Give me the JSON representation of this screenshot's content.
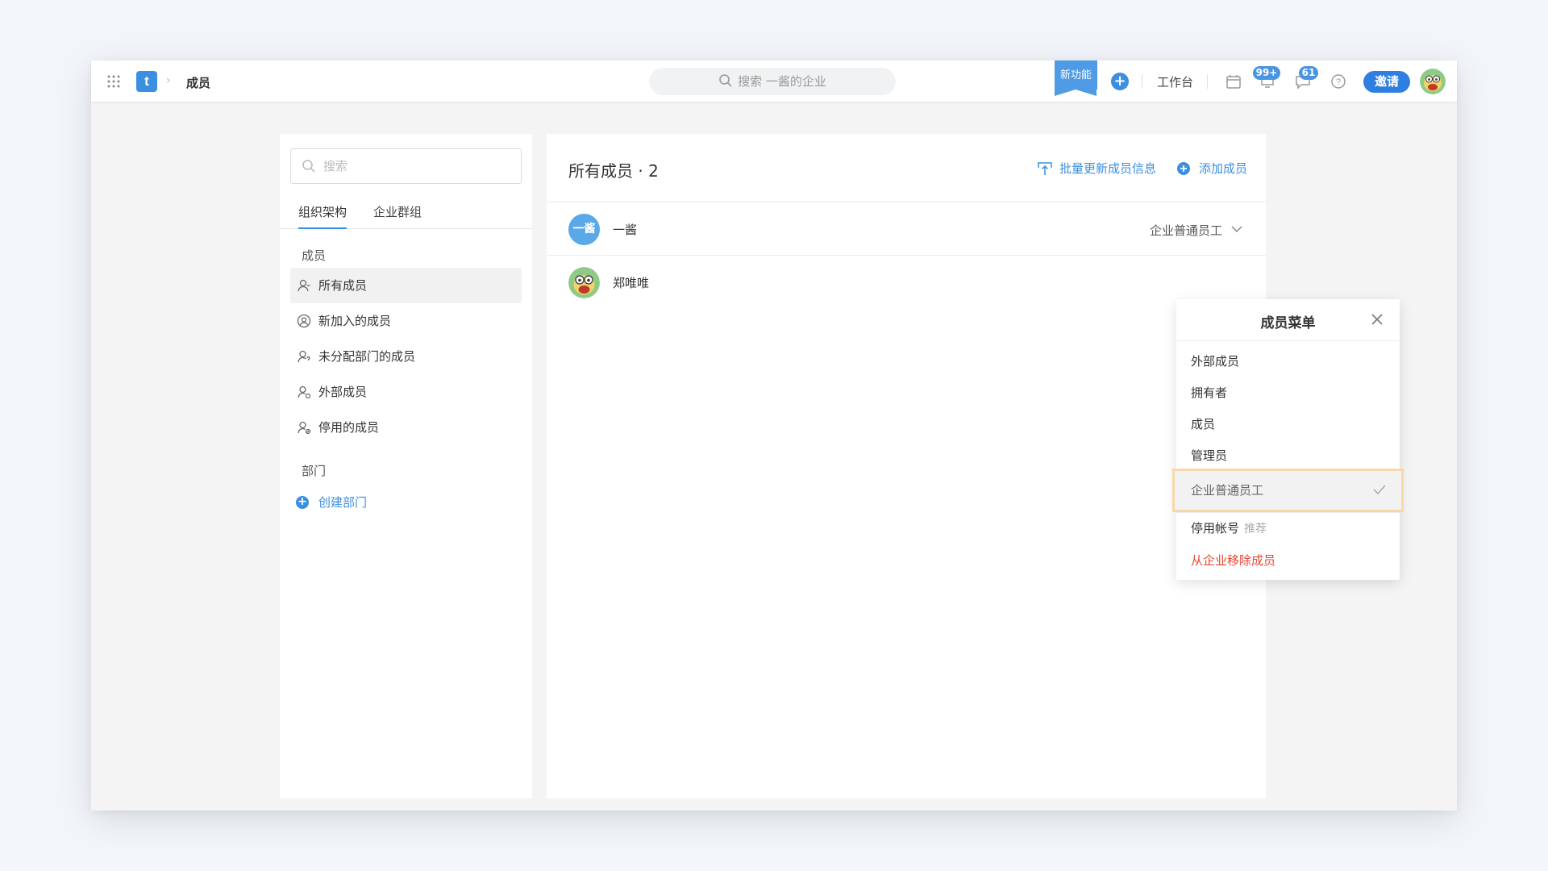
{
  "topbar": {
    "breadcrumb_title": "成员",
    "search_placeholder": "搜索 一酱的企业",
    "new_feature_label": "新功能",
    "workbench_label": "工作台",
    "notification_badge": "99+",
    "message_badge": "61",
    "invite_label": "邀请"
  },
  "sidebar": {
    "search_placeholder": "搜索",
    "tabs": [
      {
        "label": "组织架构"
      },
      {
        "label": "企业群组"
      }
    ],
    "members_section": "成员",
    "items": [
      {
        "label": "所有成员",
        "icon": "user-icon"
      },
      {
        "label": "新加入的成员",
        "icon": "user-circle-icon"
      },
      {
        "label": "未分配部门的成员",
        "icon": "user-unassigned-icon"
      },
      {
        "label": "外部成员",
        "icon": "user-external-icon"
      },
      {
        "label": "停用的成员",
        "icon": "user-disabled-icon"
      }
    ],
    "departments_section": "部门",
    "create_department": "创建部门"
  },
  "main": {
    "title": "所有成员 · 2",
    "bulk_update": "批量更新成员信息",
    "add_member": "添加成员",
    "members": [
      {
        "name": "一酱",
        "avatar_text": "一酱",
        "role": "企业普通员工"
      },
      {
        "name": "郑唯唯",
        "avatar_text": ""
      }
    ]
  },
  "member_menu": {
    "title": "成员菜单",
    "items": [
      {
        "label": "外部成员"
      },
      {
        "label": "拥有者"
      },
      {
        "label": "成员"
      },
      {
        "label": "管理员"
      },
      {
        "label": "企业普通员工"
      }
    ],
    "disable_account": "停用帐号",
    "disable_hint": "推荐",
    "remove": "从企业移除成员"
  },
  "colors": {
    "accent": "#3b8fe0",
    "danger": "#e8452f",
    "selected_outline": "#f7d9a8"
  }
}
